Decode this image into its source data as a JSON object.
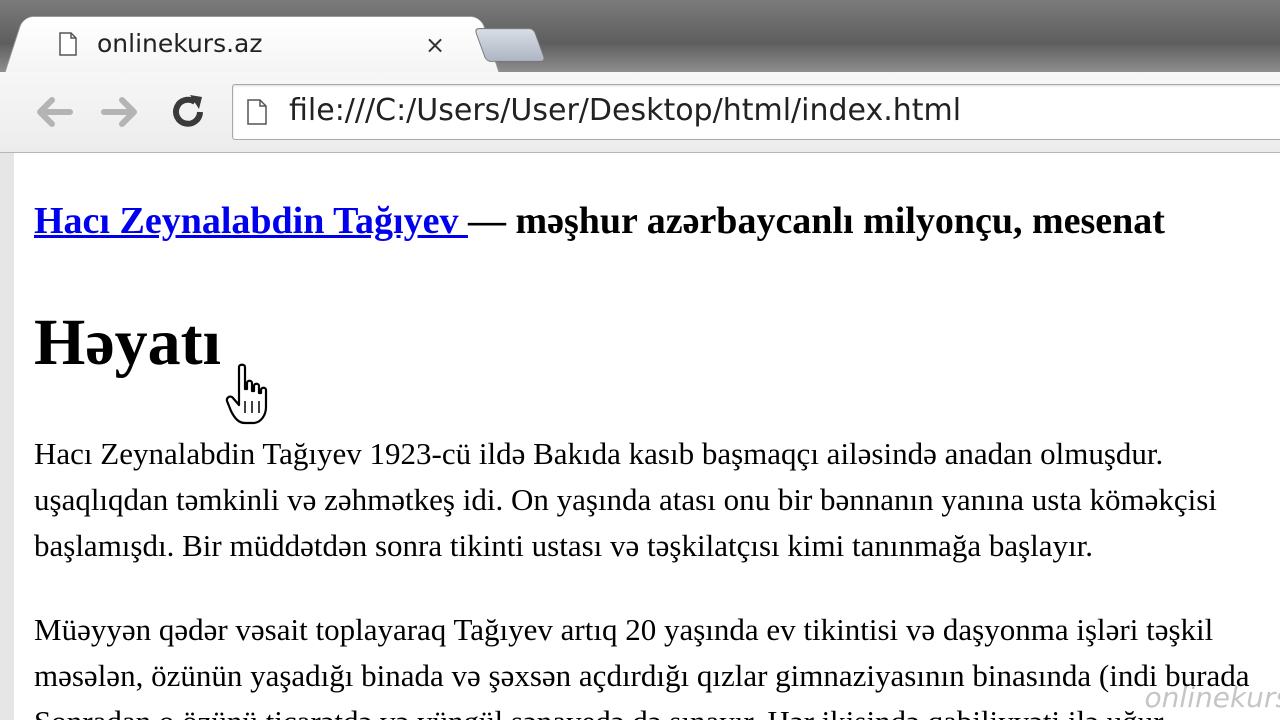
{
  "browser": {
    "tab": {
      "title": "onlinekurs.az",
      "close_symbol": "×"
    },
    "address_bar": {
      "url": "file:///C:/Users/User/Desktop/html/index.html"
    },
    "icons": {
      "back": "back-arrow-icon",
      "forward": "forward-arrow-icon",
      "reload": "reload-icon",
      "page": "page-icon"
    }
  },
  "page": {
    "intro": {
      "link_text": "Hacı Zeynalabdin Tağıyev ",
      "rest_text": "— məşhur azərbaycanlı milyonçu, mesenat"
    },
    "heading": "Həyatı",
    "paragraph1": {
      "line1": "Hacı Zeynalabdin Tağıyev 1923-cü ildə Bakıda kasıb başmaqçı ailəsində anadan olmuşdur.",
      "line2": "uşaqlıqdan təmkinli və zəhmətkeş idi. On yaşında atası onu bir bənnanın yanına usta köməkçisi",
      "line3": "başlamışdı. Bir müddətdən sonra tikinti ustası və təşkilatçısı kimi tanınmağa başlayır."
    },
    "paragraph2": {
      "line1": "Müəyyən qədər vəsait toplayaraq Tağıyev artıq 20 yaşında ev tikintisi və daşyonma işləri təşkil",
      "line2": "məsələn, özünün yaşadığı binada və şəxsən açdırdığı qızlar gimnaziyasının binasında (indi burada",
      "line3": "Sonradan o özünü ticarətdə və yüngül sənayedə də sınayır. Hər ikisində qabiliyyəti ilə uğur"
    },
    "watermark": "onlinekurs"
  },
  "colors": {
    "link": "#0000ee",
    "text": "#000000",
    "toolbar": "#f0f0f0"
  }
}
